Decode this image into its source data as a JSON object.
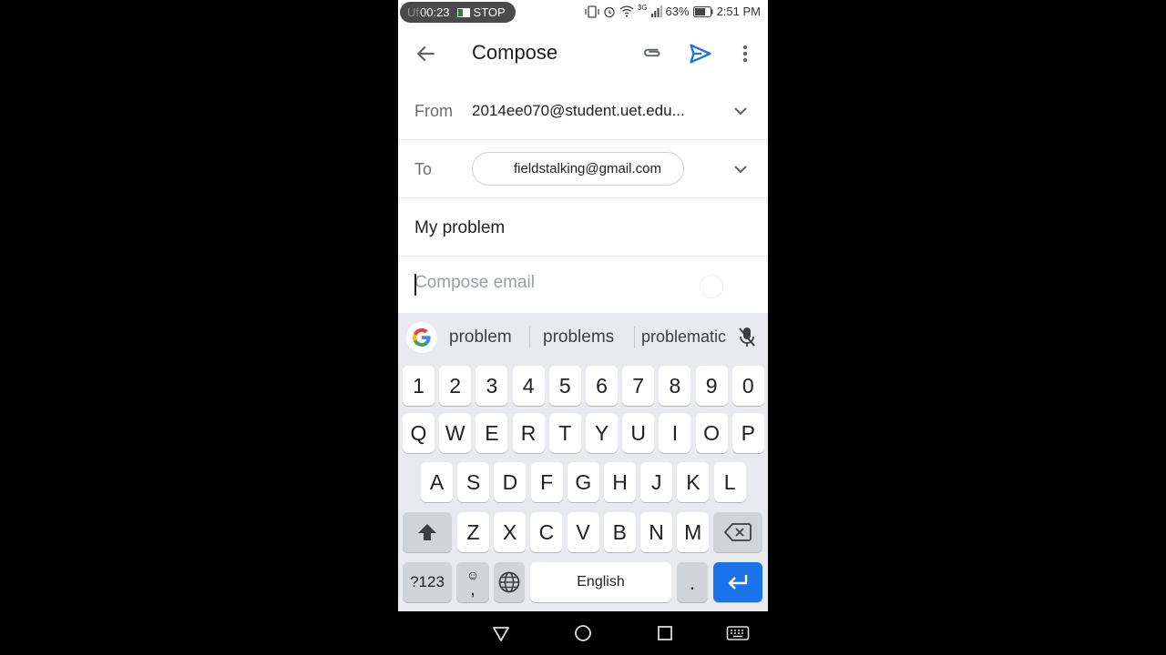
{
  "status_bar": {
    "recording_ghost": "Uf",
    "recording_time": "00:23",
    "stop_label": "STOP",
    "network": "3G",
    "battery": "63%",
    "clock": "2:51 PM",
    "icons": [
      "vibrate-icon",
      "alarm-icon",
      "wifi-icon",
      "signal-icon",
      "battery-icon"
    ]
  },
  "app_bar": {
    "title": "Compose",
    "icons": [
      "back-arrow-icon",
      "attachment-icon",
      "send-icon",
      "more-vert-icon"
    ],
    "accent_color": "#1a73e8"
  },
  "form": {
    "from_label": "From",
    "from_value": "2014ee070@student.uet.edu...",
    "to_label": "To",
    "to_chip": "fieldstalking@gmail.com",
    "subject": "My problem",
    "body_placeholder": "Compose email"
  },
  "keyboard": {
    "suggestions": [
      "problem",
      "problems",
      "problematic"
    ],
    "number_row": [
      "1",
      "2",
      "3",
      "4",
      "5",
      "6",
      "7",
      "8",
      "9",
      "0"
    ],
    "row1": [
      "Q",
      "W",
      "E",
      "R",
      "T",
      "Y",
      "U",
      "I",
      "O",
      "P"
    ],
    "row2": [
      "A",
      "S",
      "D",
      "F",
      "G",
      "H",
      "J",
      "K",
      "L"
    ],
    "row3": [
      "Z",
      "X",
      "C",
      "V",
      "B",
      "N",
      "M"
    ],
    "symbols_key": "?123",
    "emoji_key_top": "☺",
    "emoji_key_bottom": ",",
    "space_label": "English",
    "period_key": ".",
    "enter_color": "#1a73e8"
  },
  "nav_bar": {
    "icons": [
      "nav-back-icon",
      "nav-home-icon",
      "nav-recents-icon",
      "keyboard-icon"
    ]
  }
}
